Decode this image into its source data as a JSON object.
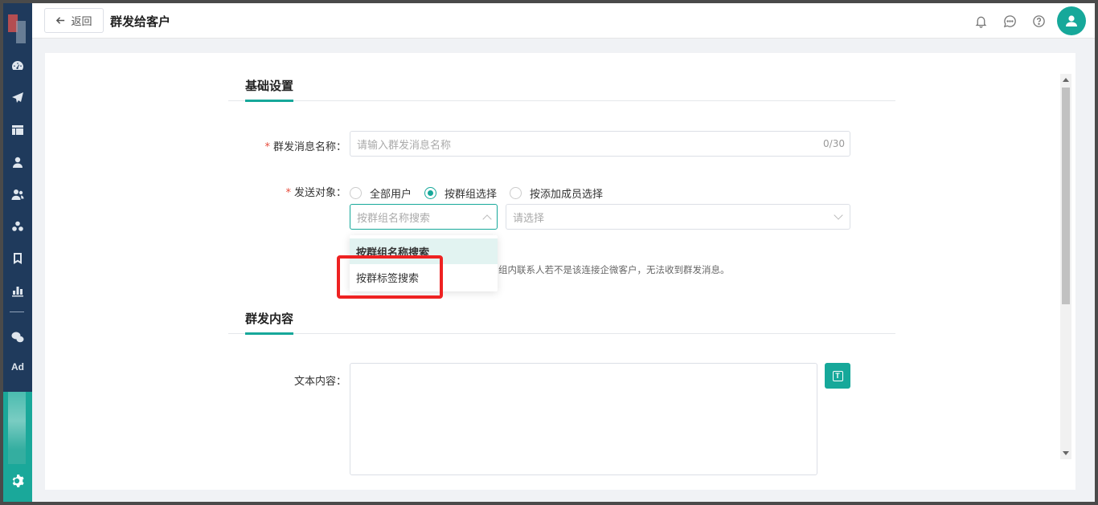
{
  "header": {
    "back_label": "返回",
    "title": "群发给客户"
  },
  "sidebar": {
    "items": [
      {
        "icon": "dashboard-icon"
      },
      {
        "icon": "send-icon"
      },
      {
        "icon": "layout-icon"
      },
      {
        "icon": "user-icon"
      },
      {
        "icon": "users-icon"
      },
      {
        "icon": "group-icon"
      },
      {
        "icon": "bookmark-icon"
      },
      {
        "icon": "bar-chart-icon"
      },
      {
        "icon": "wechat-icon"
      }
    ],
    "ad_label": "Ad"
  },
  "sections": {
    "basic": {
      "title": "基础设置"
    },
    "content": {
      "title": "群发内容"
    }
  },
  "form": {
    "name": {
      "label": "群发消息名称：",
      "placeholder": "请输入群发消息名称",
      "counter": "0/30"
    },
    "target": {
      "label": "发送对象：",
      "options": [
        "全部用户",
        "按群组选择",
        "按添加成员选择"
      ],
      "selected": "按群组选择"
    },
    "search_mode": {
      "placeholder": "按群组名称搜索"
    },
    "group_select": {
      "placeholder": "请选择"
    },
    "dropdown_options": [
      "按群组名称搜索",
      "按群标签搜索"
    ],
    "hint": "组内联系人若不是该连接企微客户，无法收到群发消息。",
    "text_content": {
      "label": "文本内容："
    }
  },
  "colors": {
    "accent": "#16a89a",
    "sidebar": "#1f3a5c",
    "required": "#e74c3c",
    "highlight": "#ee2222"
  }
}
